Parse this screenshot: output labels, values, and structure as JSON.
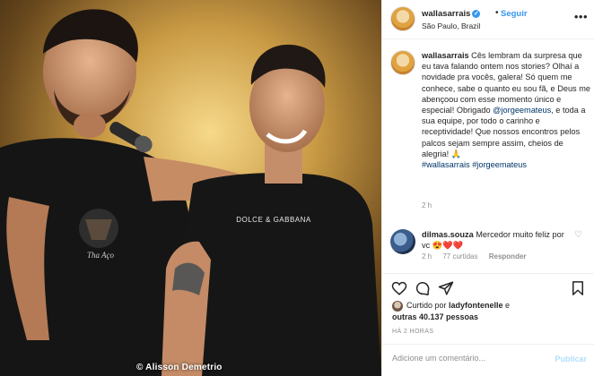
{
  "photo": {
    "credit": "© Alisson Demetrio",
    "shirt_left_text": "Tha Aço",
    "shirt_right_text": "DOLCE & GABBANA"
  },
  "header": {
    "username": "wallasarrais",
    "verified_mark": "✓",
    "separator": "•",
    "follow_label": "Seguir",
    "location": "São Paulo, Brazil",
    "more_label": "•••"
  },
  "caption": {
    "username": "wallasarrais",
    "text_1": " Cês lembram da surpresa que eu tava falando ontem nos stories? Olhaí a novidade pra vocês, galera! Só quem me conhece, sabe o quanto eu sou fã, e Deus me abençoou com esse momento único e especial! Obrigado ",
    "mention": "@jorgeemateus",
    "text_2": ", e toda a sua equipe, por todo o carinho e receptividade! Que nossos encontros pelos palcos sejam sempre assim, cheios de alegria! 🙏",
    "hashtag_1": "#wallasarrais",
    "hashtag_2": "#jorgeemateus",
    "time": "2 h"
  },
  "comment": {
    "username": "dilmas.souza",
    "text": " Mercedor muito feliz por vc 😍❤️❤️",
    "like_icon": "♡",
    "time": "2 h",
    "likes": "77 curtidas",
    "reply": "Responder"
  },
  "likes": {
    "prefix": "Curtido por ",
    "user": "ladyfontenelle",
    "middle": " e ",
    "others": "outras 40.137 pessoas"
  },
  "post_time": "HÁ 2 HORAS",
  "add_comment": {
    "placeholder": "Adicione um comentário...",
    "publish_label": "Publicar"
  },
  "icons": [
    "heart-icon",
    "comment-icon",
    "share-icon",
    "bookmark-icon"
  ],
  "colors": {
    "link": "#003569",
    "accent": "#3897f0",
    "muted": "#8e8e8e"
  }
}
